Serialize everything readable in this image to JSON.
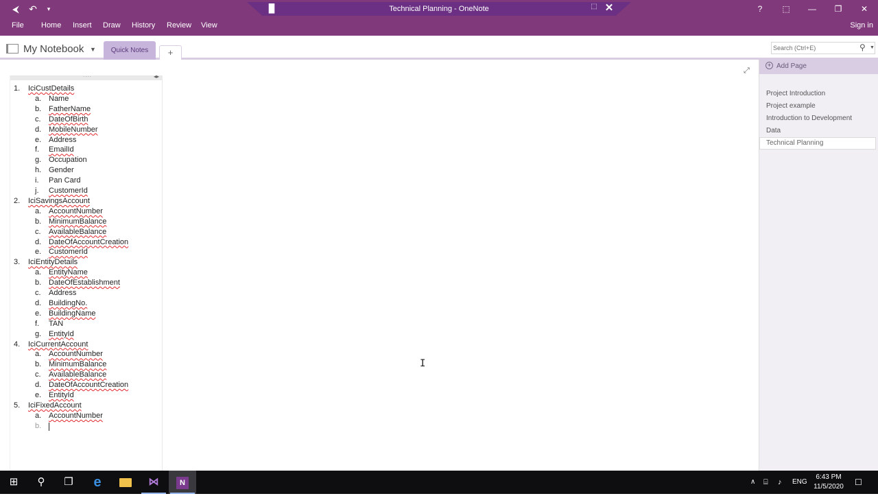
{
  "titlebar": {
    "title": "Technical Planning - OneNote",
    "help": "?",
    "back_icon": "back-arrow-icon",
    "undo_icon": "undo-icon",
    "customize_icon": "customize-qat-icon"
  },
  "ribbon": {
    "tabs": [
      "File",
      "Home",
      "Insert",
      "Draw",
      "History",
      "Review",
      "View"
    ],
    "signin": "Sign in"
  },
  "notebook": {
    "name": "My Notebook",
    "section_tab": "Quick Notes",
    "add_section": "+"
  },
  "search": {
    "placeholder": "Search (Ctrl+E)"
  },
  "outline": [
    {
      "marker": "1.",
      "text": "IciCustDetails",
      "level": 1,
      "squiggle": true
    },
    {
      "marker": "a.",
      "text": "Name",
      "level": 2,
      "squiggle": false
    },
    {
      "marker": "b.",
      "text": "FatherName",
      "level": 2,
      "squiggle": true
    },
    {
      "marker": "c.",
      "text": "DateOfBirth",
      "level": 2,
      "squiggle": true
    },
    {
      "marker": "d.",
      "text": "MobileNumber",
      "level": 2,
      "squiggle": true
    },
    {
      "marker": "e.",
      "text": "Address",
      "level": 2,
      "squiggle": false
    },
    {
      "marker": "f.",
      "text": "EmailId",
      "level": 2,
      "squiggle": true
    },
    {
      "marker": "g.",
      "text": "Occupation",
      "level": 2,
      "squiggle": false
    },
    {
      "marker": "h.",
      "text": "Gender",
      "level": 2,
      "squiggle": false
    },
    {
      "marker": "i.",
      "text": "Pan Card",
      "level": 2,
      "squiggle": false
    },
    {
      "marker": "j.",
      "text": "CustomerId",
      "level": 2,
      "squiggle": true
    },
    {
      "marker": "2.",
      "text": "IciSavingsAccount",
      "level": 1,
      "squiggle": true
    },
    {
      "marker": "a.",
      "text": "AccountNumber",
      "level": 2,
      "squiggle": true
    },
    {
      "marker": "b.",
      "text": "MinimumBalance",
      "level": 2,
      "squiggle": true
    },
    {
      "marker": "c.",
      "text": "AvailableBalance",
      "level": 2,
      "squiggle": true
    },
    {
      "marker": "d.",
      "text": "DateOfAccountCreation",
      "level": 2,
      "squiggle": true
    },
    {
      "marker": "e.",
      "text": "CustomerId",
      "level": 2,
      "squiggle": true
    },
    {
      "marker": "3.",
      "text": "IciEntityDetails",
      "level": 1,
      "squiggle": true
    },
    {
      "marker": "a.",
      "text": "EntityName",
      "level": 2,
      "squiggle": true
    },
    {
      "marker": "b.",
      "text": "DateOfEstablishment",
      "level": 2,
      "squiggle": true
    },
    {
      "marker": "c.",
      "text": "Address",
      "level": 2,
      "squiggle": false
    },
    {
      "marker": "d.",
      "text": "BuildingNo.",
      "level": 2,
      "squiggle": true
    },
    {
      "marker": "e.",
      "text": "BuildingName",
      "level": 2,
      "squiggle": true
    },
    {
      "marker": "f.",
      "text": "TAN",
      "level": 2,
      "squiggle": false
    },
    {
      "marker": "g.",
      "text": "EntityId",
      "level": 2,
      "squiggle": true
    },
    {
      "marker": "4.",
      "text": "IciCurrentAccount",
      "level": 1,
      "squiggle": true
    },
    {
      "marker": "a.",
      "text": "AccountNumber",
      "level": 2,
      "squiggle": true
    },
    {
      "marker": "b.",
      "text": "MinimumBalance",
      "level": 2,
      "squiggle": true
    },
    {
      "marker": "c.",
      "text": "AvailableBalance",
      "level": 2,
      "squiggle": true
    },
    {
      "marker": "d.",
      "text": "DateOfAccountCreation",
      "level": 2,
      "squiggle": true
    },
    {
      "marker": "e.",
      "text": "EntityId",
      "level": 2,
      "squiggle": true
    },
    {
      "marker": "5.",
      "text": "IciFixedAccount",
      "level": 1,
      "squiggle": true
    },
    {
      "marker": "a.",
      "text": "AccountNumber",
      "level": 2,
      "squiggle": true
    },
    {
      "marker": "b.",
      "text": "",
      "level": 2,
      "squiggle": false,
      "faded": true,
      "caret": true
    }
  ],
  "pages": {
    "add_label": "Add Page",
    "items": [
      {
        "label": "Project Introduction",
        "active": false
      },
      {
        "label": "Project example",
        "active": false
      },
      {
        "label": "Introduction to Development",
        "active": false
      },
      {
        "label": "Data",
        "active": false
      },
      {
        "label": "Technical Planning",
        "active": true
      }
    ]
  },
  "taskbar": {
    "lang": "ENG",
    "time": "6:43 PM",
    "date": "11/5/2020"
  },
  "colors": {
    "accent": "#80397b",
    "section_tab": "#c8b5dc",
    "page_pane": "#f1eef4",
    "spell_error": "#e0262a"
  }
}
